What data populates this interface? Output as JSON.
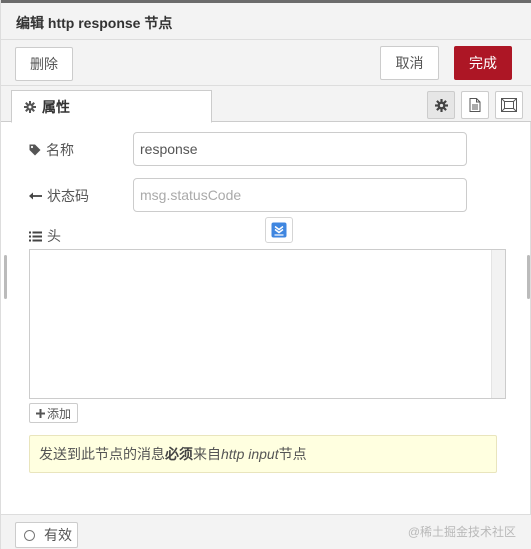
{
  "dialog": {
    "title": "编辑 http response 节点"
  },
  "toolbar": {
    "delete_label": "删除",
    "cancel_label": "取消",
    "done_label": "完成"
  },
  "tabs": {
    "properties_label": "属性",
    "icon_buttons": [
      "gear-icon",
      "document-icon",
      "frame-icon"
    ]
  },
  "form": {
    "name_label": "名称",
    "name_value": "response",
    "status_label": "状态码",
    "status_placeholder": "msg.statusCode",
    "headers_label": "头",
    "add_label": "添加"
  },
  "tip": {
    "prefix": "发送到此节点的消息",
    "bold": "必须",
    "middle": "来自",
    "italic": "http input",
    "suffix": "节点"
  },
  "footer": {
    "enabled_label": "有效",
    "watermark": "@稀土掘金技术社区"
  },
  "colors": {
    "accent": "#ad1625",
    "tip_background": "#ffffe0",
    "panel_background": "#f3f3f3"
  }
}
